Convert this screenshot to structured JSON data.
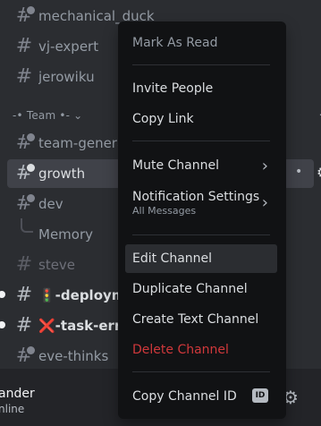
{
  "channels": [
    {
      "name": "mechanical_duck"
    },
    {
      "name": "vj-expert"
    },
    {
      "name": "jerowiku"
    },
    {
      "name": "team-general"
    },
    {
      "name": "growth"
    },
    {
      "name": "dev"
    },
    {
      "name": "Memory"
    },
    {
      "name": "steve"
    },
    {
      "name": "🚦-deployments"
    },
    {
      "name": "❌-task-errors"
    },
    {
      "name": "eve-thinks"
    }
  ],
  "category": {
    "label": "-• Team •- ⌄",
    "add": "+"
  },
  "user": {
    "name": "ander",
    "status": "nline"
  },
  "menu": {
    "mark_as_read": "Mark As Read",
    "invite_people": "Invite People",
    "copy_link": "Copy Link",
    "mute_channel": "Mute Channel",
    "notification_settings": "Notification Settings",
    "notification_value": "All Messages",
    "edit_channel": "Edit Channel",
    "duplicate_channel": "Duplicate Channel",
    "create_text_channel": "Create Text Channel",
    "delete_channel": "Delete Channel",
    "copy_channel_id": "Copy Channel ID",
    "id_badge": "ID"
  },
  "colors": {
    "danger": "#f23f42",
    "background": "#2b2d31",
    "menu": "#111214"
  }
}
